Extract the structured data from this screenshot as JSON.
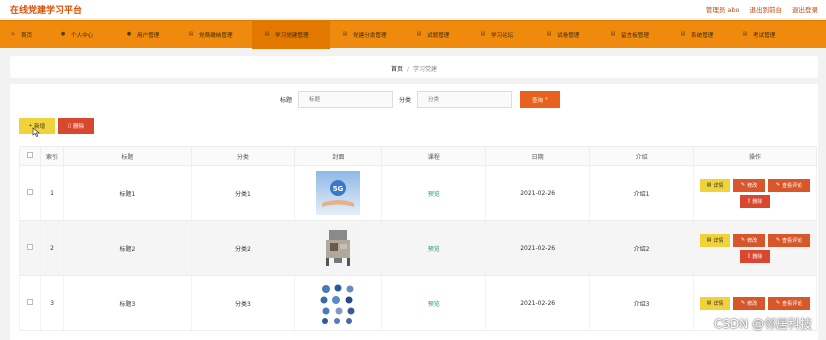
{
  "app": {
    "title": "在线党建学习平台"
  },
  "top_right": {
    "user": "管理员 abo",
    "back": "退出到前台",
    "logout": "退出登录"
  },
  "nav": [
    {
      "label": "首页",
      "icon": "home-icon"
    },
    {
      "label": "个人中心",
      "icon": "user-icon"
    },
    {
      "label": "用户管理",
      "icon": "users-icon"
    },
    {
      "label": "党费缴纳管理",
      "icon": "menu-icon"
    },
    {
      "label": "学习党建管理",
      "icon": "menu-icon"
    },
    {
      "label": "党建分类管理",
      "icon": "menu-icon"
    },
    {
      "label": "试题管理",
      "icon": "menu-icon"
    },
    {
      "label": "学习论坛",
      "icon": "menu-icon"
    },
    {
      "label": "试卷管理",
      "icon": "menu-icon"
    },
    {
      "label": "留言板管理",
      "icon": "menu-icon"
    },
    {
      "label": "系统管理",
      "icon": "menu-icon"
    },
    {
      "label": "考试管理",
      "icon": "menu-icon"
    }
  ],
  "breadcrumb": {
    "home": "首页",
    "sep": "/",
    "current": "学习党建"
  },
  "search": {
    "title_label": "标题",
    "title_placeholder": "标题",
    "category_label": "分类",
    "category_placeholder": "分类",
    "query_label": "查询"
  },
  "actions": {
    "add": "新增",
    "delete": "删除"
  },
  "table": {
    "headers": [
      "",
      "索引",
      "标题",
      "分类",
      "封面",
      "课程",
      "日期",
      "介绍",
      "操作"
    ],
    "rows": [
      {
        "index": "1",
        "title": "标题1",
        "category": "分类1",
        "cover": "5G",
        "course": "预览",
        "date": "2021-02-26",
        "intro": "介绍1"
      },
      {
        "index": "2",
        "title": "标题2",
        "category": "分类2",
        "cover": "",
        "course": "预览",
        "date": "2021-02-26",
        "intro": "介绍2"
      },
      {
        "index": "3",
        "title": "标题3",
        "category": "分类3",
        "cover": "",
        "course": "预览",
        "date": "2021-02-26",
        "intro": "介绍3"
      }
    ],
    "ops": {
      "detail": "详情",
      "edit": "修改",
      "comments": "查看评论",
      "delete": "删除"
    }
  },
  "watermark": "CSDN @邻居科技",
  "colors": {
    "nav_bg": "#f08a0c",
    "accent": "#d8540c",
    "add_btn": "#f0d23a",
    "delete_btn": "#d8472e",
    "link_green": "#2a9a5a"
  }
}
